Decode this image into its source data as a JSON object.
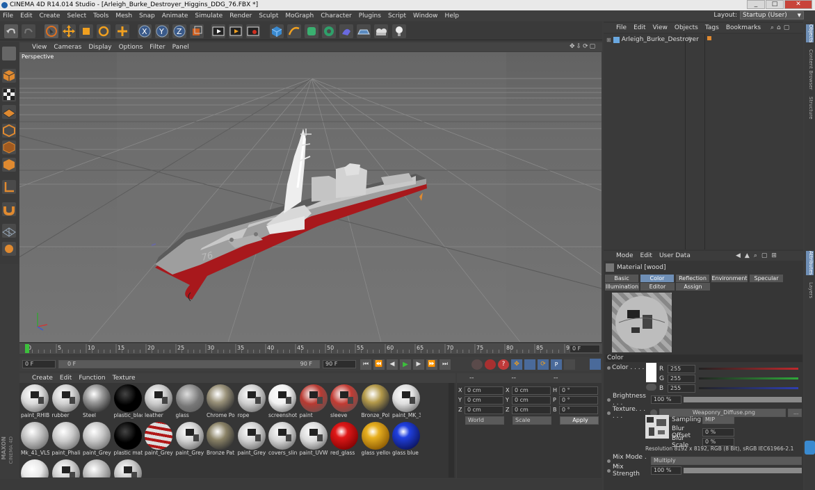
{
  "window": {
    "title": "CINEMA 4D R14.014 Studio - [Arleigh_Burke_Destroyer_Higgins_DDG_76.FBX *]",
    "minimize": "_",
    "maximize": "□",
    "close": "✕"
  },
  "menu": [
    "File",
    "Edit",
    "Create",
    "Select",
    "Tools",
    "Mesh",
    "Snap",
    "Animate",
    "Simulate",
    "Render",
    "Sculpt",
    "MoGraph",
    "Character",
    "Plugins",
    "Script",
    "Window",
    "Help"
  ],
  "layout": {
    "label": "Layout:",
    "value": "Startup (User)"
  },
  "viewport": {
    "menu": [
      "View",
      "Cameras",
      "Display",
      "Options",
      "Filter",
      "Panel"
    ],
    "camera_label": "Perspective",
    "hull_number": "76"
  },
  "timeline": {
    "ticks": [
      "0",
      "5",
      "10",
      "15",
      "20",
      "25",
      "30",
      "35",
      "40",
      "45",
      "50",
      "55",
      "60",
      "65",
      "70",
      "75",
      "80",
      "85",
      "90"
    ],
    "current_frame": "0 F"
  },
  "transport": {
    "start": "0 F",
    "slider_start": "0 F",
    "slider_end": "90 F",
    "end": "90 F"
  },
  "materials": {
    "menu": [
      "Create",
      "Edit",
      "Function",
      "Texture"
    ],
    "items": [
      {
        "name": "paint_RHIB",
        "color": "#d9d9d9",
        "style": "decal"
      },
      {
        "name": "rubber",
        "color": "#cfcfcf",
        "style": "decal"
      },
      {
        "name": "Steel",
        "color": "#9a9a9a",
        "style": "metal"
      },
      {
        "name": "plastic_blac",
        "color": "#050505",
        "style": "black"
      },
      {
        "name": "leather",
        "color": "#cacaca",
        "style": "decal"
      },
      {
        "name": "glass",
        "color": "#8a8a8a",
        "style": "glass"
      },
      {
        "name": "Chrome Pol",
        "color": "#9a927a",
        "style": "metal"
      },
      {
        "name": "rope",
        "color": "#d0d0d0",
        "style": "decal"
      },
      {
        "name": "screenshot",
        "color": "#f2f2f2",
        "style": "decal"
      },
      {
        "name": "paint",
        "color": "#b83a32",
        "style": "decal"
      },
      {
        "name": "sleeve",
        "color": "#c23b33",
        "style": "decal"
      },
      {
        "name": "Bronze_Pol",
        "color": "#b49a4a",
        "style": "metal"
      },
      {
        "name": "paint_MK_3",
        "color": "#dedede",
        "style": "decal"
      },
      {
        "name": "Mk_41_VLS",
        "color": "#bdbdbd",
        "style": "plain"
      },
      {
        "name": "paint_Phali",
        "color": "#c9c9c9",
        "style": "plain"
      },
      {
        "name": "paint_Grey",
        "color": "#c4c4c4",
        "style": "plain"
      },
      {
        "name": "plastic mat",
        "color": "#050505",
        "style": "black"
      },
      {
        "name": "paint_Grey",
        "color": "#d8d8d8",
        "style": "stripe"
      },
      {
        "name": "paint_Grey",
        "color": "#cfcfcf",
        "style": "decal"
      },
      {
        "name": "Bronze Pat",
        "color": "#8a8266",
        "style": "metal"
      },
      {
        "name": "paint_Grey",
        "color": "#cfcfcf",
        "style": "decal"
      },
      {
        "name": "covers_slin",
        "color": "#d3d3d3",
        "style": "decal"
      },
      {
        "name": "paint_UVW",
        "color": "#dadada",
        "style": "decal"
      },
      {
        "name": "red_glass",
        "color": "#c40a0a",
        "style": "red"
      },
      {
        "name": "glass yellov",
        "color": "#d4a00a",
        "style": "yellow"
      },
      {
        "name": "glass blue",
        "color": "#0a1fb8",
        "style": "blue"
      },
      {
        "name": "",
        "color": "#e8e8e8",
        "style": "plain"
      },
      {
        "name": "",
        "color": "#cfcfcf",
        "style": "decal"
      },
      {
        "name": "",
        "color": "#bcbcbc",
        "style": "plain"
      },
      {
        "name": "",
        "color": "#c8c8c8",
        "style": "decal"
      }
    ]
  },
  "coords": {
    "header": [
      "--",
      "--",
      "--"
    ],
    "rows": [
      {
        "a": "X",
        "av": "0 cm",
        "b": "X",
        "bv": "0 cm",
        "c": "H",
        "cv": "0 °"
      },
      {
        "a": "Y",
        "av": "0 cm",
        "b": "Y",
        "bv": "0 cm",
        "c": "P",
        "cv": "0 °"
      },
      {
        "a": "Z",
        "av": "0 cm",
        "b": "Z",
        "bv": "0 cm",
        "c": "B",
        "cv": "0 °"
      }
    ],
    "world": "World",
    "scale": "Scale",
    "apply": "Apply"
  },
  "objects": {
    "menu": [
      "File",
      "Edit",
      "View",
      "Objects",
      "Tags",
      "Bookmarks"
    ],
    "root": "Arleigh_Burke_Destroyer"
  },
  "attributes": {
    "menu": [
      "Mode",
      "Edit",
      "User Data"
    ],
    "material_name": "Material [wood]",
    "tabs_row1": [
      "Basic",
      "Color",
      "Reflection",
      "Environment",
      "Specular"
    ],
    "tabs_row2": [
      "Illumination",
      "Editor",
      "Assign"
    ],
    "active_tab": "Color",
    "section": "Color",
    "color_label": "Color . . . . . .",
    "r": {
      "label": "R",
      "value": "255"
    },
    "g": {
      "label": "G",
      "value": "255"
    },
    "b": {
      "label": "B",
      "value": "255"
    },
    "brightness": {
      "label": "Brightness . . .",
      "value": "100 %"
    },
    "texture": {
      "label": "Texture. . . . . .",
      "file": "Weaponry_Diffuse.png",
      "more": "..."
    },
    "sampling": {
      "label": "Sampling",
      "value": "MIP"
    },
    "blur_offset": {
      "label": "Blur Offset",
      "value": "0 %"
    },
    "blur_scale": {
      "label": "Blur Scale",
      "value": "0 %"
    },
    "resolution": "Resolution 8192 x 8192, RGB (8 Bit), sRGB IEC61966-2.1",
    "mix_mode": {
      "label": "Mix Mode . . .",
      "value": "Multiply"
    },
    "mix_strength": {
      "label": "Mix Strength",
      "value": "100 %"
    }
  },
  "side_tabs": [
    "Objects",
    "Content Browser",
    "Structure"
  ],
  "side_tabs_attr": [
    "Attributes",
    "Layers"
  ],
  "branding": {
    "maxon": "MAXON",
    "product": "CINEMA 4D"
  },
  "colors": {
    "accent": "#6f8fb6",
    "red_ch": "#c0282c",
    "green_ch": "#2fa83a",
    "blue_ch": "#2f3fb0",
    "hull_red": "#a8181c"
  }
}
